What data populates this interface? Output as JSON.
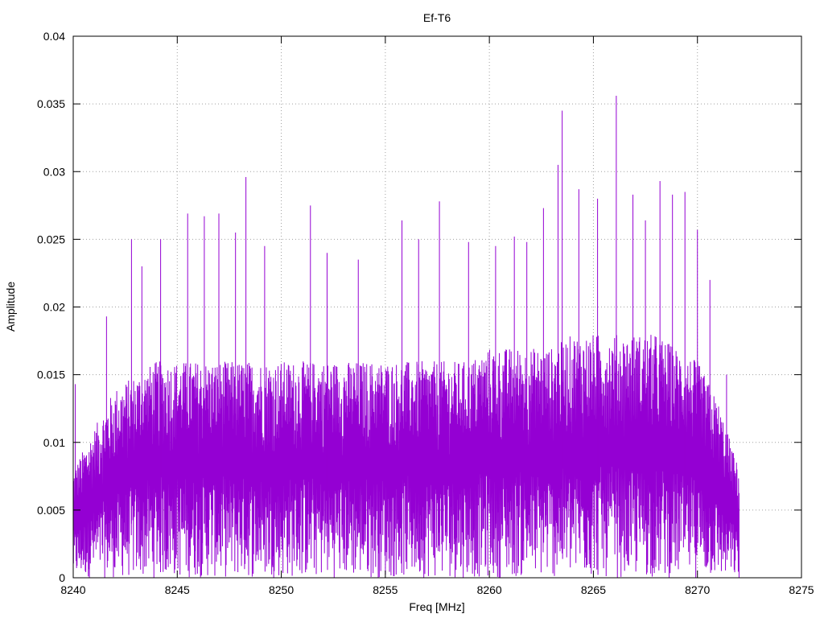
{
  "chart_data": {
    "type": "line",
    "title": "Ef-T6",
    "xlabel": "Freq [MHz]",
    "ylabel": "Amplitude",
    "xlim": [
      8240,
      8275
    ],
    "ylim": [
      0,
      0.04
    ],
    "x_ticks": [
      "8240",
      "8245",
      "8250",
      "8255",
      "8260",
      "8265",
      "8270",
      "8275"
    ],
    "y_ticks": [
      "0",
      "0.005",
      "0.01",
      "0.015",
      "0.02",
      "0.025",
      "0.03",
      "0.035",
      "0.04"
    ],
    "x_tick_values": [
      8240,
      8245,
      8250,
      8255,
      8260,
      8265,
      8270,
      8275
    ],
    "y_tick_values": [
      0,
      0.005,
      0.01,
      0.015,
      0.02,
      0.025,
      0.03,
      0.035,
      0.04
    ],
    "grid": true,
    "series_color": "#9400d3",
    "data_range": [
      8240,
      8272
    ],
    "envelope": {
      "x": [
        8240,
        8241,
        8242,
        8243,
        8244,
        8245,
        8246,
        8247,
        8248,
        8249,
        8250,
        8251,
        8252,
        8253,
        8254,
        8255,
        8256,
        8257,
        8258,
        8259,
        8260,
        8261,
        8262,
        8263,
        8264,
        8265,
        8266,
        8267,
        8268,
        8269,
        8270,
        8271,
        8272
      ],
      "low": [
        0.001,
        0.002,
        0.002,
        0.0025,
        0.003,
        0.003,
        0.003,
        0.003,
        0.003,
        0.003,
        0.003,
        0.003,
        0.003,
        0.003,
        0.003,
        0.003,
        0.003,
        0.003,
        0.003,
        0.003,
        0.003,
        0.003,
        0.003,
        0.003,
        0.003,
        0.003,
        0.003,
        0.003,
        0.003,
        0.003,
        0.003,
        0.002,
        0.001
      ],
      "high": [
        0.008,
        0.011,
        0.014,
        0.015,
        0.016,
        0.016,
        0.016,
        0.016,
        0.016,
        0.016,
        0.016,
        0.016,
        0.016,
        0.016,
        0.016,
        0.016,
        0.016,
        0.016,
        0.016,
        0.016,
        0.017,
        0.017,
        0.017,
        0.017,
        0.018,
        0.018,
        0.018,
        0.018,
        0.018,
        0.017,
        0.016,
        0.013,
        0.008
      ]
    },
    "peaks": [
      {
        "x": 8240.1,
        "y": 0.0143
      },
      {
        "x": 8241.6,
        "y": 0.0193
      },
      {
        "x": 8242.8,
        "y": 0.025
      },
      {
        "x": 8243.3,
        "y": 0.023
      },
      {
        "x": 8244.2,
        "y": 0.025
      },
      {
        "x": 8245.5,
        "y": 0.0269
      },
      {
        "x": 8246.3,
        "y": 0.0267
      },
      {
        "x": 8247.0,
        "y": 0.0269
      },
      {
        "x": 8247.8,
        "y": 0.0255
      },
      {
        "x": 8248.3,
        "y": 0.0296
      },
      {
        "x": 8249.2,
        "y": 0.0245
      },
      {
        "x": 8251.4,
        "y": 0.0275
      },
      {
        "x": 8252.2,
        "y": 0.024
      },
      {
        "x": 8253.7,
        "y": 0.0235
      },
      {
        "x": 8255.8,
        "y": 0.0264
      },
      {
        "x": 8256.6,
        "y": 0.025
      },
      {
        "x": 8257.6,
        "y": 0.0278
      },
      {
        "x": 8259.0,
        "y": 0.0248
      },
      {
        "x": 8260.3,
        "y": 0.0245
      },
      {
        "x": 8261.2,
        "y": 0.0252
      },
      {
        "x": 8261.8,
        "y": 0.0248
      },
      {
        "x": 8262.6,
        "y": 0.0273
      },
      {
        "x": 8263.3,
        "y": 0.0305
      },
      {
        "x": 8263.5,
        "y": 0.0345
      },
      {
        "x": 8264.3,
        "y": 0.0287
      },
      {
        "x": 8265.2,
        "y": 0.028
      },
      {
        "x": 8266.1,
        "y": 0.0356
      },
      {
        "x": 8266.9,
        "y": 0.0283
      },
      {
        "x": 8267.5,
        "y": 0.0264
      },
      {
        "x": 8268.2,
        "y": 0.0293
      },
      {
        "x": 8268.8,
        "y": 0.0283
      },
      {
        "x": 8269.4,
        "y": 0.0285
      },
      {
        "x": 8270.0,
        "y": 0.0257
      },
      {
        "x": 8270.6,
        "y": 0.022
      },
      {
        "x": 8271.4,
        "y": 0.015
      },
      {
        "x": 8271.9,
        "y": 0.008
      }
    ]
  }
}
